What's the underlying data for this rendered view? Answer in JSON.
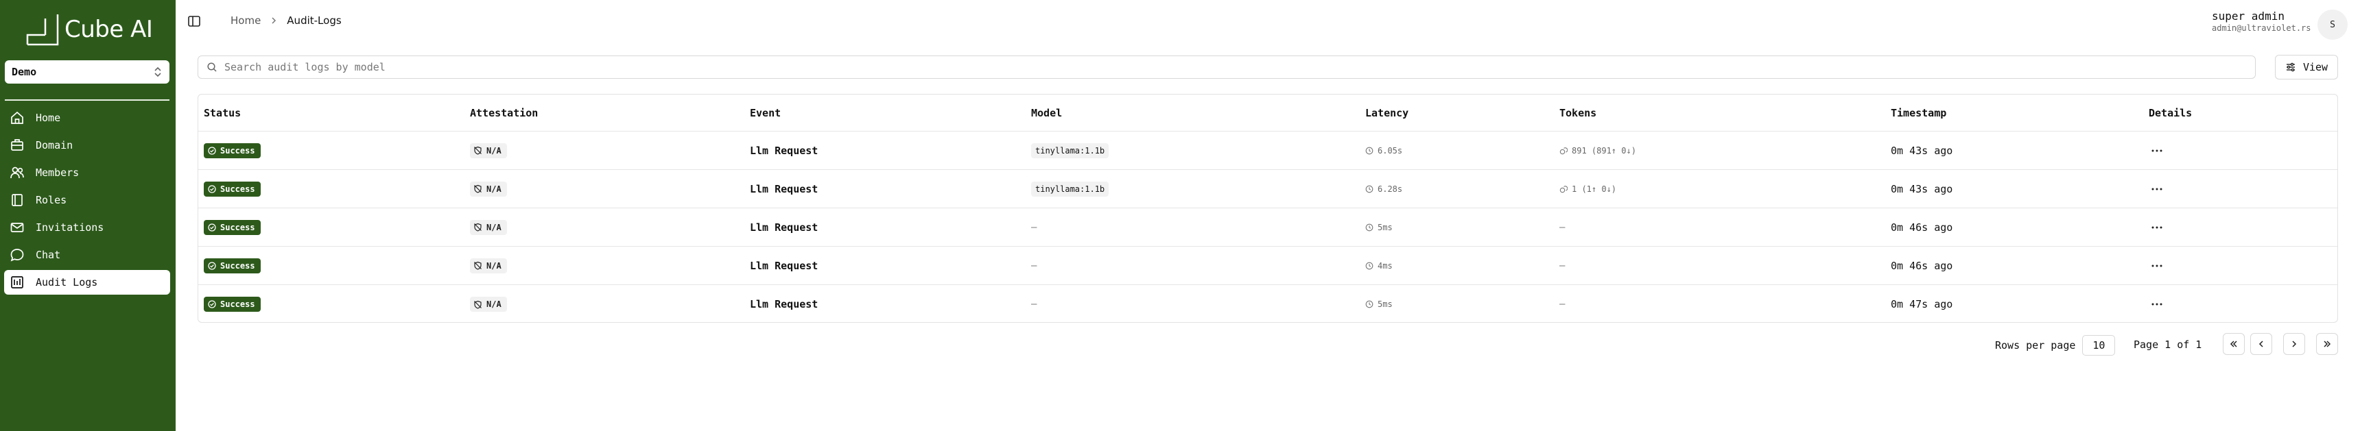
{
  "app": {
    "name": "Cube AI",
    "workspace": "Demo"
  },
  "sidebar": {
    "items": [
      {
        "label": "Home",
        "icon": "home-icon"
      },
      {
        "label": "Domain",
        "icon": "domain-icon"
      },
      {
        "label": "Members",
        "icon": "members-icon"
      },
      {
        "label": "Roles",
        "icon": "roles-icon"
      },
      {
        "label": "Invitations",
        "icon": "mail-icon"
      },
      {
        "label": "Chat",
        "icon": "chat-icon"
      },
      {
        "label": "Audit Logs",
        "icon": "audit-logs-icon",
        "active": true
      }
    ]
  },
  "header": {
    "breadcrumb": {
      "home": "Home",
      "current": "Audit-Logs"
    },
    "user": {
      "name": "super admin",
      "email": "admin@ultraviolet.rs",
      "initial": "S"
    }
  },
  "toolbar": {
    "search_placeholder": "Search audit logs by model",
    "view_label": "View"
  },
  "table": {
    "columns": [
      "Status",
      "Attestation",
      "Event",
      "Model",
      "Latency",
      "Tokens",
      "Timestamp",
      "Details"
    ],
    "rows": [
      {
        "status": "Success",
        "attestation": "N/A",
        "event": "Llm Request",
        "model": "tinyllama:1.1b",
        "latency": "6.05s",
        "tokens": "891 (891↑ 0↓)",
        "timestamp": "0m 43s ago"
      },
      {
        "status": "Success",
        "attestation": "N/A",
        "event": "Llm Request",
        "model": "tinyllama:1.1b",
        "latency": "6.28s",
        "tokens": "1 (1↑ 0↓)",
        "timestamp": "0m 43s ago"
      },
      {
        "status": "Success",
        "attestation": "N/A",
        "event": "Llm Request",
        "model": "—",
        "latency": "5ms",
        "tokens": "—",
        "timestamp": "0m 46s ago"
      },
      {
        "status": "Success",
        "attestation": "N/A",
        "event": "Llm Request",
        "model": "—",
        "latency": "4ms",
        "tokens": "—",
        "timestamp": "0m 46s ago"
      },
      {
        "status": "Success",
        "attestation": "N/A",
        "event": "Llm Request",
        "model": "—",
        "latency": "5ms",
        "tokens": "—",
        "timestamp": "0m 47s ago"
      }
    ]
  },
  "pagination": {
    "rows_per_page_label": "Rows per page",
    "rows_per_page": "10",
    "page_info": "Page 1 of 1"
  },
  "colors": {
    "brand": "#2d5a1b",
    "sidebar_bg": "#2d5a1b"
  }
}
